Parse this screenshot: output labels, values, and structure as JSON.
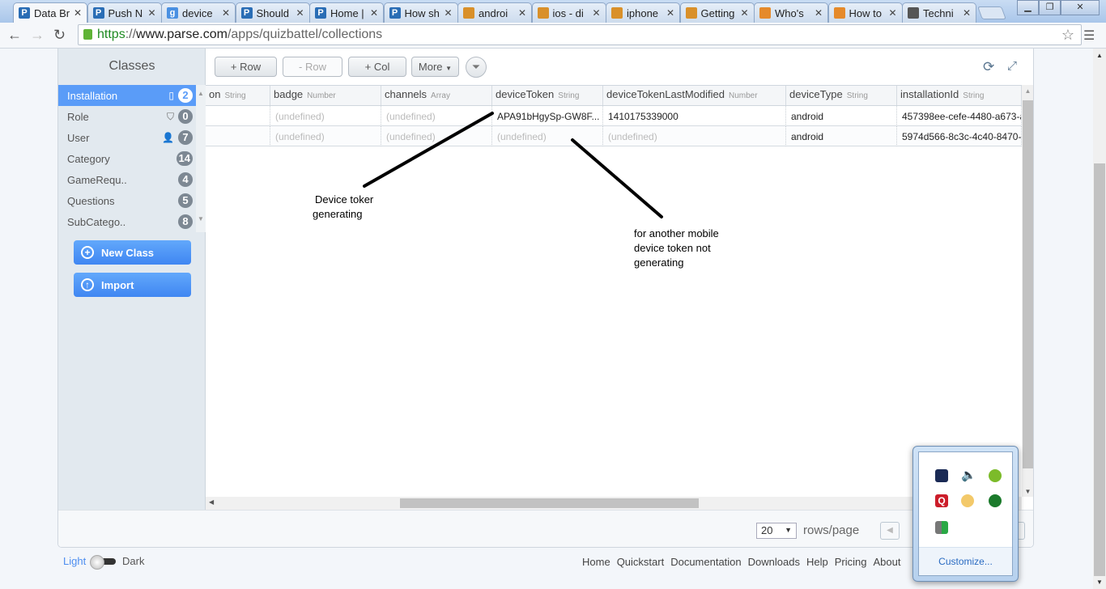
{
  "browser": {
    "tabs": [
      {
        "title": "Data Br",
        "icon": "parse-icon",
        "color": "#2a6db5",
        "active": true
      },
      {
        "title": "Push N",
        "icon": "parse-icon",
        "color": "#2a6db5"
      },
      {
        "title": "device",
        "icon": "google-icon",
        "color": "#4a90e2"
      },
      {
        "title": "Should",
        "icon": "parse-icon",
        "color": "#2a6db5"
      },
      {
        "title": "Home |",
        "icon": "parse-icon",
        "color": "#2a6db5"
      },
      {
        "title": "How sh",
        "icon": "parse-icon",
        "color": "#2a6db5"
      },
      {
        "title": "androi",
        "icon": "stackoverflow-icon",
        "color": "#d9902a"
      },
      {
        "title": "ios - di",
        "icon": "stackoverflow-icon",
        "color": "#d9902a"
      },
      {
        "title": "iphone",
        "icon": "stackoverflow-icon",
        "color": "#d9902a"
      },
      {
        "title": "Getting",
        "icon": "stackoverflow-icon",
        "color": "#d9902a"
      },
      {
        "title": "Who's",
        "icon": "chat-bubble-icon",
        "color": "#e58a2b"
      },
      {
        "title": "How to",
        "icon": "chat-bubble-icon",
        "color": "#e58a2b"
      },
      {
        "title": "Techni",
        "icon": "apple-icon",
        "color": "#555555"
      }
    ],
    "url": {
      "scheme": "https",
      "sep": "://",
      "host": "www.parse.com",
      "path": "/apps/quizbattel/collections"
    }
  },
  "sidebar": {
    "title": "Classes",
    "items": [
      {
        "name": "Installation",
        "count": "2",
        "icon": "mobile-icon",
        "selected": true
      },
      {
        "name": "Role",
        "count": "0",
        "icon": "shield-icon"
      },
      {
        "name": "User",
        "count": "7",
        "icon": "user-icon"
      },
      {
        "name": "Category",
        "count": "14"
      },
      {
        "name": "GameRequ..",
        "count": "4"
      },
      {
        "name": "Questions",
        "count": "5"
      },
      {
        "name": "SubCatego..",
        "count": "8"
      }
    ],
    "new_class": "New Class",
    "import": "Import"
  },
  "toolbar": {
    "add_row": "+ Row",
    "remove_row": "- Row",
    "add_col": "+ Col",
    "more": "More"
  },
  "table": {
    "columns": [
      {
        "name": "on",
        "type": "String"
      },
      {
        "name": "badge",
        "type": "Number"
      },
      {
        "name": "channels",
        "type": "Array"
      },
      {
        "name": "deviceToken",
        "type": "String"
      },
      {
        "name": "deviceTokenLastModified",
        "type": "Number"
      },
      {
        "name": "deviceType",
        "type": "String"
      },
      {
        "name": "installationId",
        "type": "String"
      }
    ],
    "rows": [
      [
        "",
        "(undefined)",
        "(undefined)",
        "APA91bHgySp-GW8F...",
        "1410175339000",
        "android",
        "457398ee-cefe-4480-a673-a"
      ],
      [
        "",
        "(undefined)",
        "(undefined)",
        "(undefined)",
        "(undefined)",
        "android",
        "5974d566-8c3c-4c40-8470-"
      ]
    ]
  },
  "pager": {
    "rows_per_page": "20",
    "label": "rows/page"
  },
  "annotations": {
    "a1": [
      "Device toker",
      "generating"
    ],
    "a2": [
      "for another mobile",
      "device token not",
      "generating"
    ]
  },
  "footer": {
    "light": "Light",
    "dark": "Dark",
    "links": [
      "Home",
      "Quickstart",
      "Documentation",
      "Downloads",
      "Help",
      "Pricing",
      "About"
    ]
  },
  "tray": {
    "customize": "Customize..."
  }
}
